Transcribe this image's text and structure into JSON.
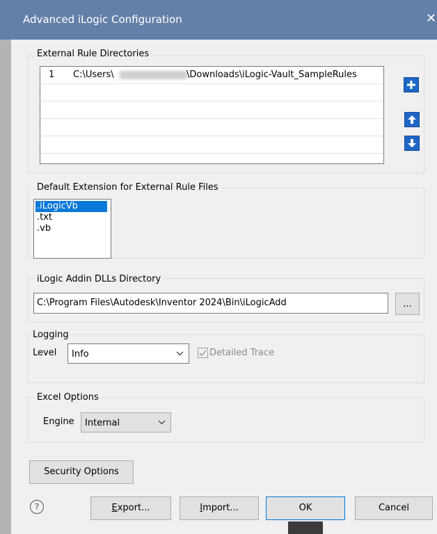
{
  "window": {
    "title": "Advanced iLogic Configuration",
    "close_glyph": "✕"
  },
  "external_rules": {
    "group_label": "External Rule Directories",
    "rows": [
      {
        "index": "1",
        "path_prefix": "C:\\Users\\",
        "path_suffix": "\\Downloads\\iLogic-Vault_SampleRules"
      }
    ],
    "buttons": {
      "add": "plus-icon",
      "up": "arrow-up-icon",
      "down": "arrow-down-icon"
    }
  },
  "default_extension": {
    "group_label": "Default Extension for External Rule Files",
    "items": [
      ".iLogicVb",
      ".txt",
      ".vb"
    ],
    "selected": ".iLogicVb"
  },
  "addin_dlls": {
    "group_label": "iLogic Addin DLLs Directory",
    "path": "C:\\Program Files\\Autodesk\\Inventor 2024\\Bin\\iLogicAdd",
    "browse_label": "..."
  },
  "logging": {
    "group_label": "Logging",
    "level_label": "Level",
    "level_value": "Info",
    "detailed_trace_label": "Detailed Trace",
    "detailed_trace_checked": true
  },
  "excel": {
    "group_label": "Excel Options",
    "engine_label": "Engine",
    "engine_value": "Internal"
  },
  "buttons": {
    "security": "Security Options",
    "export_mnemonic": "E",
    "export_rest": "xport...",
    "import_mnemonic": "I",
    "import_rest": "mport...",
    "ok": "OK",
    "cancel": "Cancel",
    "help_glyph": "?"
  },
  "colors": {
    "titlebar": "#6380a8",
    "selection": "#0a78d7",
    "icon_button": "#1f67c6"
  }
}
